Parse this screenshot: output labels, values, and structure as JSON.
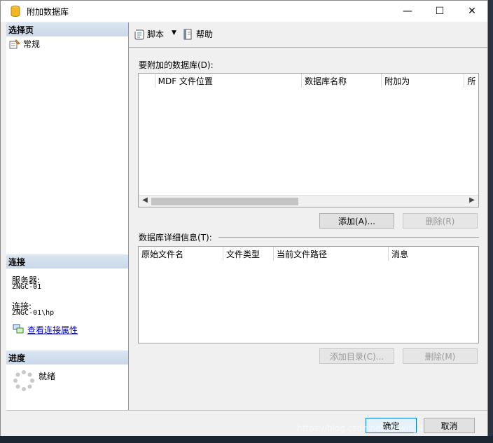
{
  "window": {
    "title": "附加数据库",
    "minimize": "—",
    "maximize": "☐",
    "close": "✕"
  },
  "left": {
    "select_page_header": "选择页",
    "nav_item_general": "常规",
    "connection_header": "连接",
    "server_label": "服务器:",
    "server_value": "ZNGC-01",
    "connection_label": "连接:",
    "connection_value": "ZNGC-01\\hp",
    "view_connection_link": "查看连接属性",
    "progress_header": "进度",
    "progress_status": "就绪"
  },
  "toolbar": {
    "script_label": "脚本",
    "dropdown_glyph": "▼",
    "help_label": "帮助"
  },
  "attach_section": {
    "label": "要附加的数据库(D):",
    "columns": [
      "",
      "MDF 文件位置",
      "数据库名称",
      "附加为",
      "所"
    ],
    "add_button": "添加(A)...",
    "remove_button": "删除(R)"
  },
  "details_section": {
    "label": "数据库详细信息(T):",
    "columns": [
      "原始文件名",
      "文件类型",
      "当前文件路径",
      "消息"
    ],
    "add_catalog_button": "添加目录(C)...",
    "remove_button": "删除(M)"
  },
  "footer": {
    "ok_button": "确定",
    "cancel_button": "取消"
  },
  "watermark": "https://blog.csdn.net/weixin_4"
}
